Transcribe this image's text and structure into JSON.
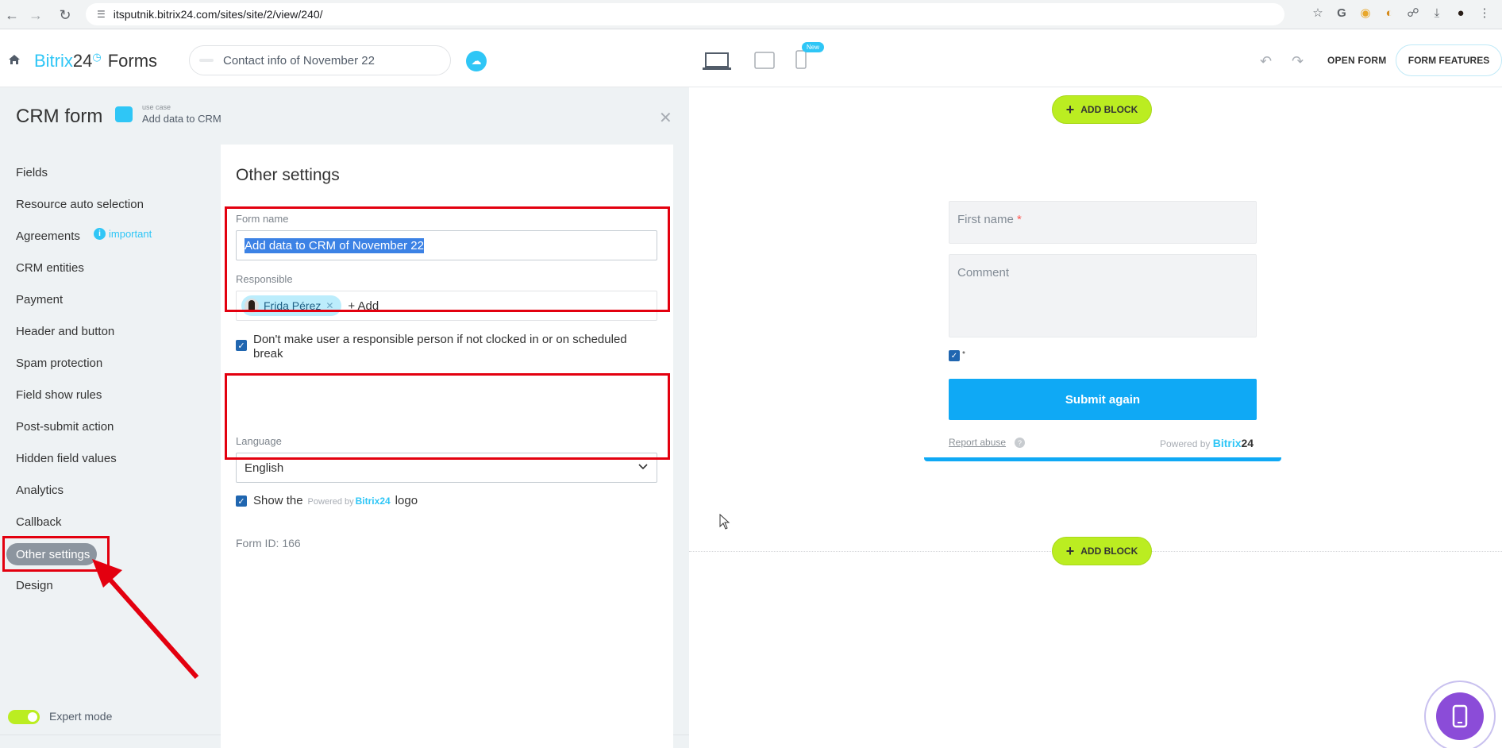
{
  "browser": {
    "url": "itsputnik.bitrix24.com/sites/site/2/view/240/"
  },
  "header": {
    "brand_main": "Bitrix",
    "brand_num": "24",
    "brand_forms": "Forms",
    "page_title": "Contact info of November 22",
    "new_badge": "New",
    "open_form": "OPEN FORM",
    "form_features": "FORM FEATURES"
  },
  "panel": {
    "title": "CRM form",
    "use_case_label": "use case",
    "use_case_value": "Add data to CRM",
    "menu": [
      "Fields",
      "Resource auto selection",
      "Agreements",
      "CRM entities",
      "Payment",
      "Header and button",
      "Spam protection",
      "Field show rules",
      "Post-submit action",
      "Hidden field values",
      "Analytics",
      "Callback",
      "Other settings",
      "Design"
    ],
    "important_label": "important",
    "expert_mode": "Expert mode"
  },
  "settings": {
    "title": "Other settings",
    "form_name_label": "Form name",
    "form_name_value": "Add data to CRM of November 22",
    "responsible_label": "Responsible",
    "responsible_user": "Frida Pérez",
    "add_label": "+ Add",
    "clocked_in_text": "Don't make user a responsible person if not clocked in or on scheduled break",
    "language_label": "Language",
    "language_value": "English",
    "show_the": "Show the",
    "powered_by_small": "Powered by",
    "bitrix24": "Bitrix24",
    "logo_word": "logo",
    "form_id": "Form ID: 166"
  },
  "preview": {
    "add_block": "ADD BLOCK",
    "first_name": "First name",
    "required_star": "*",
    "comment": "Comment",
    "agreement_star": "*",
    "submit": "Submit again",
    "report_abuse": "Report abuse",
    "powered_by": "Powered by",
    "bitrix": "Bitrix",
    "b24_num": "24"
  },
  "colors": {
    "accent": "#2fc6f6",
    "highlight_red": "#e3000f",
    "add_block_green": "#bbed21",
    "submit_blue": "#0fa9f5"
  }
}
